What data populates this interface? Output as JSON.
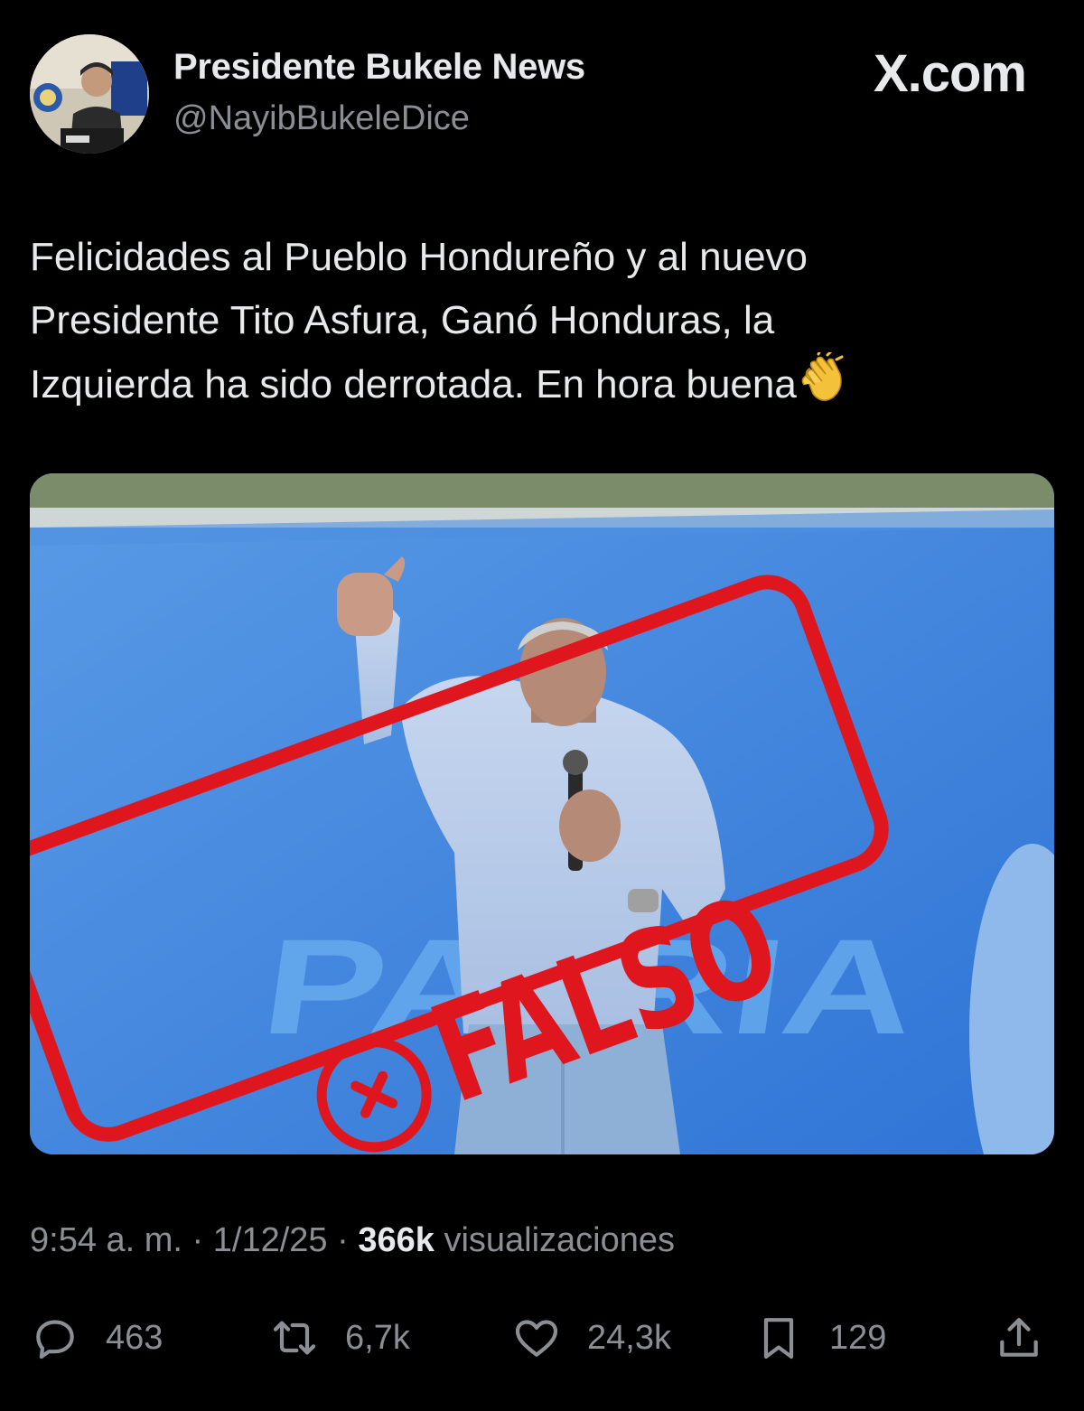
{
  "account": {
    "display_name": "Presidente Bukele News",
    "handle": "@NayibBukeleDice"
  },
  "brand": "X.com",
  "tweet": {
    "text": "Felicidades al Pueblo Hondureño y al nuevo\nPresidente Tito Asfura, Ganó Honduras, la\nIzquierda ha sido derrotada. En hora buena",
    "emoji": "clapping-hands"
  },
  "media": {
    "stamp_text": "FALSO",
    "background_text": "PATRIA",
    "stamp_color": "#e0161f"
  },
  "meta": {
    "time": "9:54 a. m.",
    "date": "1/12/25",
    "views": "366k",
    "views_label": "visualizaciones"
  },
  "actions": {
    "replies": "463",
    "reposts": "6,7k",
    "likes": "24,3k",
    "bookmarks": "129"
  },
  "colors": {
    "background": "#000000",
    "text": "#e7e9ea",
    "muted": "#8b8f94"
  }
}
